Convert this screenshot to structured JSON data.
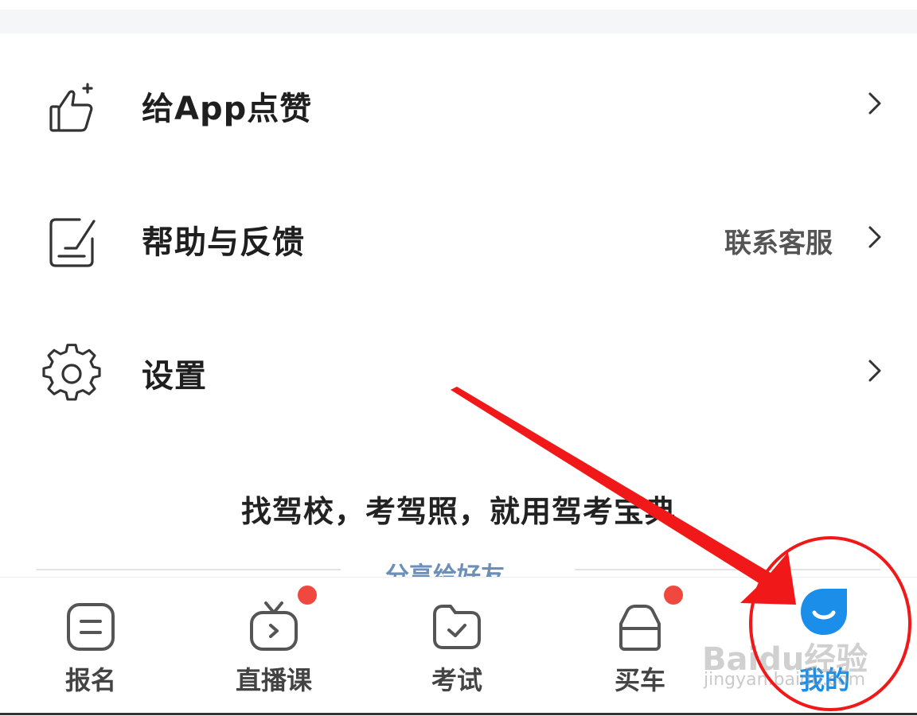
{
  "menu": {
    "items": [
      {
        "label": "给App点赞",
        "sub": "",
        "icon": "thumbs-up-icon"
      },
      {
        "label": "帮助与反馈",
        "sub": "联系客服",
        "icon": "feedback-icon"
      },
      {
        "label": "设置",
        "sub": "",
        "icon": "gear-icon"
      }
    ]
  },
  "slogan": "找驾校，考驾照，就用驾考宝典",
  "share": {
    "label": "分享给好友"
  },
  "tabbar": {
    "tabs": [
      {
        "label": "报名",
        "icon": "signup-icon",
        "badge": false
      },
      {
        "label": "直播课",
        "icon": "live-tv-icon",
        "badge": true
      },
      {
        "label": "考试",
        "icon": "exam-folder-icon",
        "badge": false
      },
      {
        "label": "买车",
        "icon": "car-icon",
        "badge": true
      },
      {
        "label": "我的",
        "icon": "mine-drop-icon",
        "badge": false,
        "active": true
      }
    ]
  },
  "watermark": {
    "text": "Baidu经验",
    "sub": "jingyan.baidu.com"
  },
  "colors": {
    "accent": "#1a8ee8",
    "badge": "#f0483e",
    "annotation": "#f01818"
  }
}
